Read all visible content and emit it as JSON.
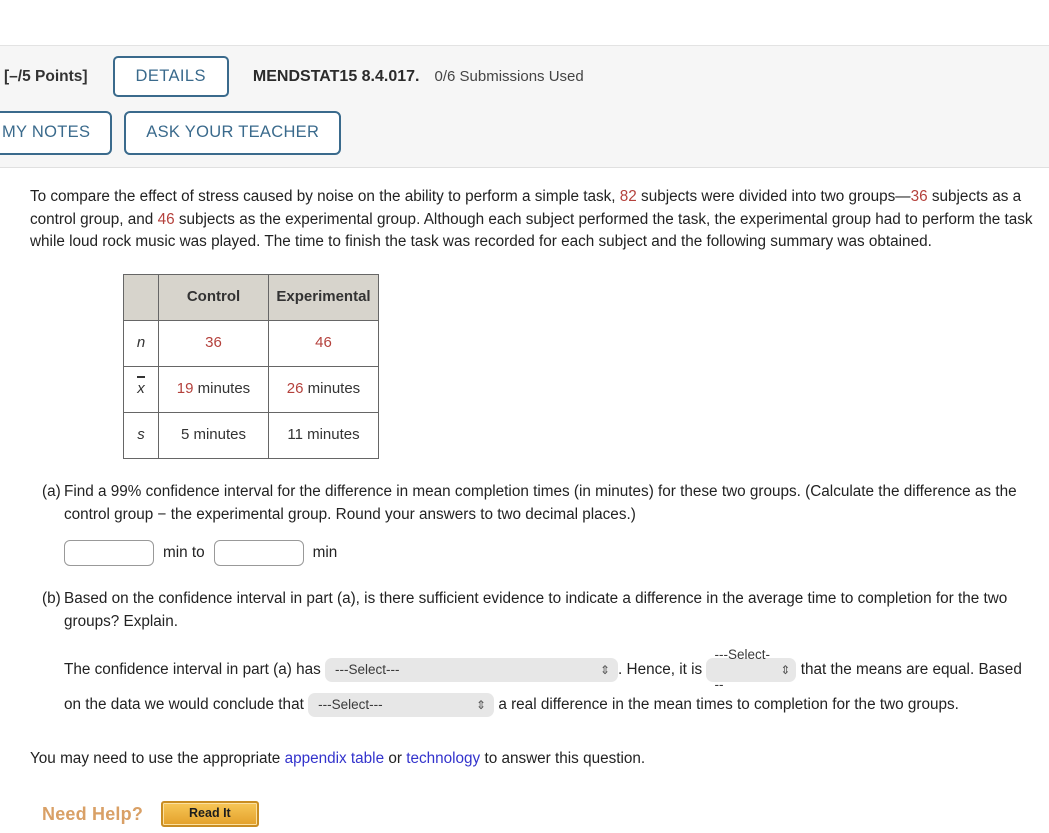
{
  "header": {
    "points_label": "[–/5 Points]",
    "details_label": "DETAILS",
    "question_id": "MENDSTAT15 8.4.017.",
    "submissions": "0/6 Submissions Used",
    "my_notes_label": "MY NOTES",
    "ask_teacher_label": "ASK YOUR TEACHER"
  },
  "question": {
    "intro_1": "To compare the effect of stress caused by noise on the ability to perform a simple task, ",
    "total_subjects": "82",
    "intro_2": " subjects were divided into two groups—",
    "control_n": "36",
    "intro_3": " subjects as a control group, and ",
    "experimental_n": "46",
    "intro_4": " subjects as the experimental group. Although each subject performed the task, the experimental group had to perform the task while loud rock music was played. The time to finish the task was recorded for each subject and the following summary was obtained."
  },
  "table": {
    "corner": "",
    "headers": [
      "Control",
      "Experimental"
    ],
    "rows": [
      {
        "label": "n",
        "label_type": "plain",
        "control": "36",
        "experimental": "46",
        "control_red": "36",
        "experimental_red": "46",
        "control_rest": "",
        "experimental_rest": ""
      },
      {
        "label": "x",
        "label_type": "xbar",
        "control_red": "19",
        "control_rest": " minutes",
        "experimental_red": "26",
        "experimental_rest": " minutes"
      },
      {
        "label": "s",
        "label_type": "plain",
        "control_red": "",
        "control_rest": "5 minutes",
        "experimental_red": "",
        "experimental_rest": "11 minutes"
      }
    ]
  },
  "part_a": {
    "label": "(a)",
    "text": "Find a 99% confidence interval for the difference in mean completion times (in minutes) for these two groups. (Calculate the difference as the control group − the experimental group. Round your answers to two decimal places.)",
    "lower_value": "",
    "upper_value": "",
    "unit_between": "min to",
    "unit_after": "min"
  },
  "part_b": {
    "label": "(b)",
    "text": "Based on the confidence interval in part (a), is there sufficient evidence to indicate a difference in the average time to completion for the two groups? Explain.",
    "sentence_1": "The confidence interval in part (a) has",
    "select_1": "---Select---",
    "sentence_2": ". Hence, it is",
    "select_2": "---Select---",
    "sentence_3": "that the means are equal. Based on the data we would conclude that",
    "select_3": "---Select---",
    "sentence_4": "a real difference in the mean times to completion for the two groups."
  },
  "footer": {
    "note_1": "You may need to use the appropriate ",
    "link_1": "appendix table",
    "note_2": " or ",
    "link_2": "technology",
    "note_3": " to answer this question.",
    "need_help_label": "Need Help?",
    "read_it_label": "Read It"
  },
  "icons": {
    "select_chevron": "⇕"
  }
}
